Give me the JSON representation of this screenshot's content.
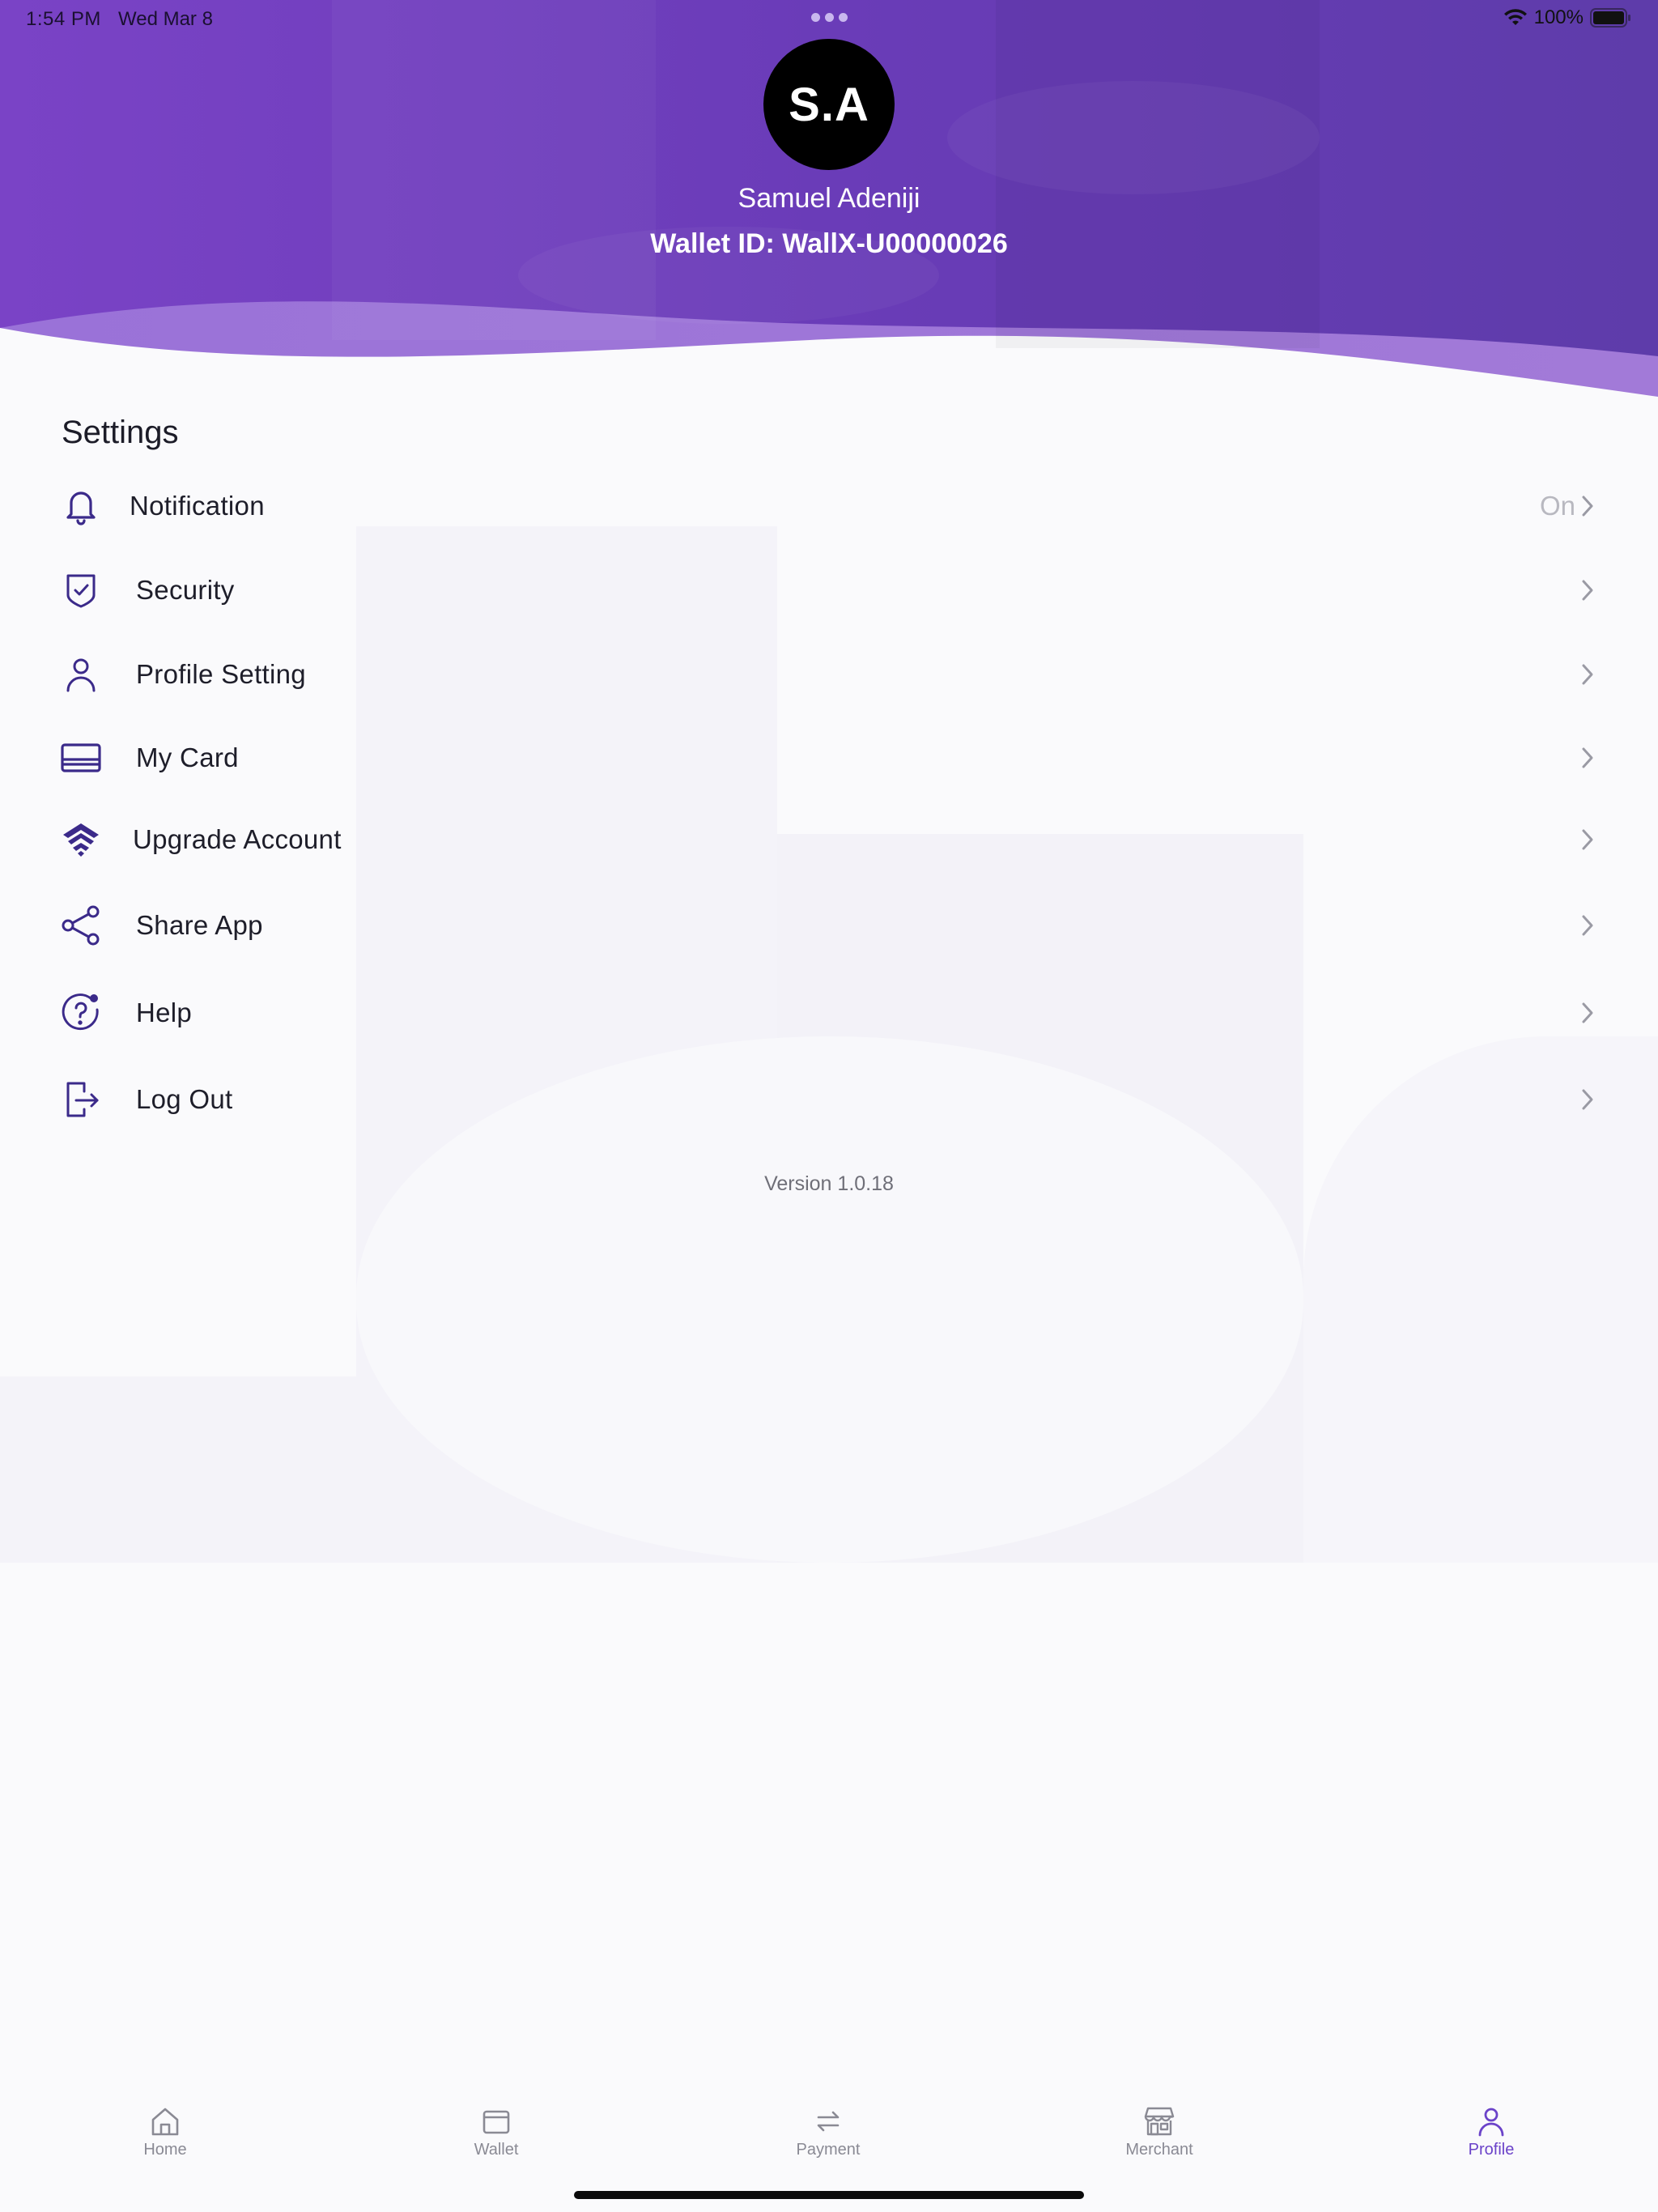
{
  "status_bar": {
    "time": "1:54 PM",
    "date": "Wed Mar 8",
    "battery": "100%"
  },
  "profile": {
    "initials": "S.A",
    "name": "Samuel Adeniji",
    "wallet_id": "Wallet ID: WallX-U00000026"
  },
  "settings": {
    "title": "Settings",
    "items": [
      {
        "label": "Notification",
        "value": "On",
        "icon": "bell-icon"
      },
      {
        "label": "Security",
        "value": "",
        "icon": "shield-check-icon"
      },
      {
        "label": "Profile Setting",
        "value": "",
        "icon": "person-icon"
      },
      {
        "label": "My Card",
        "value": "",
        "icon": "card-icon"
      },
      {
        "label": "Upgrade Account",
        "value": "",
        "icon": "upgrade-chevrons-icon"
      },
      {
        "label": "Share App",
        "value": "",
        "icon": "share-icon"
      },
      {
        "label": "Help",
        "value": "",
        "icon": "help-icon"
      },
      {
        "label": "Log Out",
        "value": "",
        "icon": "logout-icon"
      }
    ]
  },
  "version": "Version 1.0.18",
  "tabbar": {
    "tabs": [
      {
        "label": "Home",
        "icon": "home-icon"
      },
      {
        "label": "Wallet",
        "icon": "wallet-icon"
      },
      {
        "label": "Payment",
        "icon": "transfer-arrows-icon"
      },
      {
        "label": "Merchant",
        "icon": "store-icon"
      },
      {
        "label": "Profile",
        "icon": "person-icon"
      }
    ],
    "active": "Profile"
  },
  "colors": {
    "brand_purple": "#6b43c9",
    "header_purple": "#6a3fc0",
    "icon_color": "#3b2a8a"
  }
}
